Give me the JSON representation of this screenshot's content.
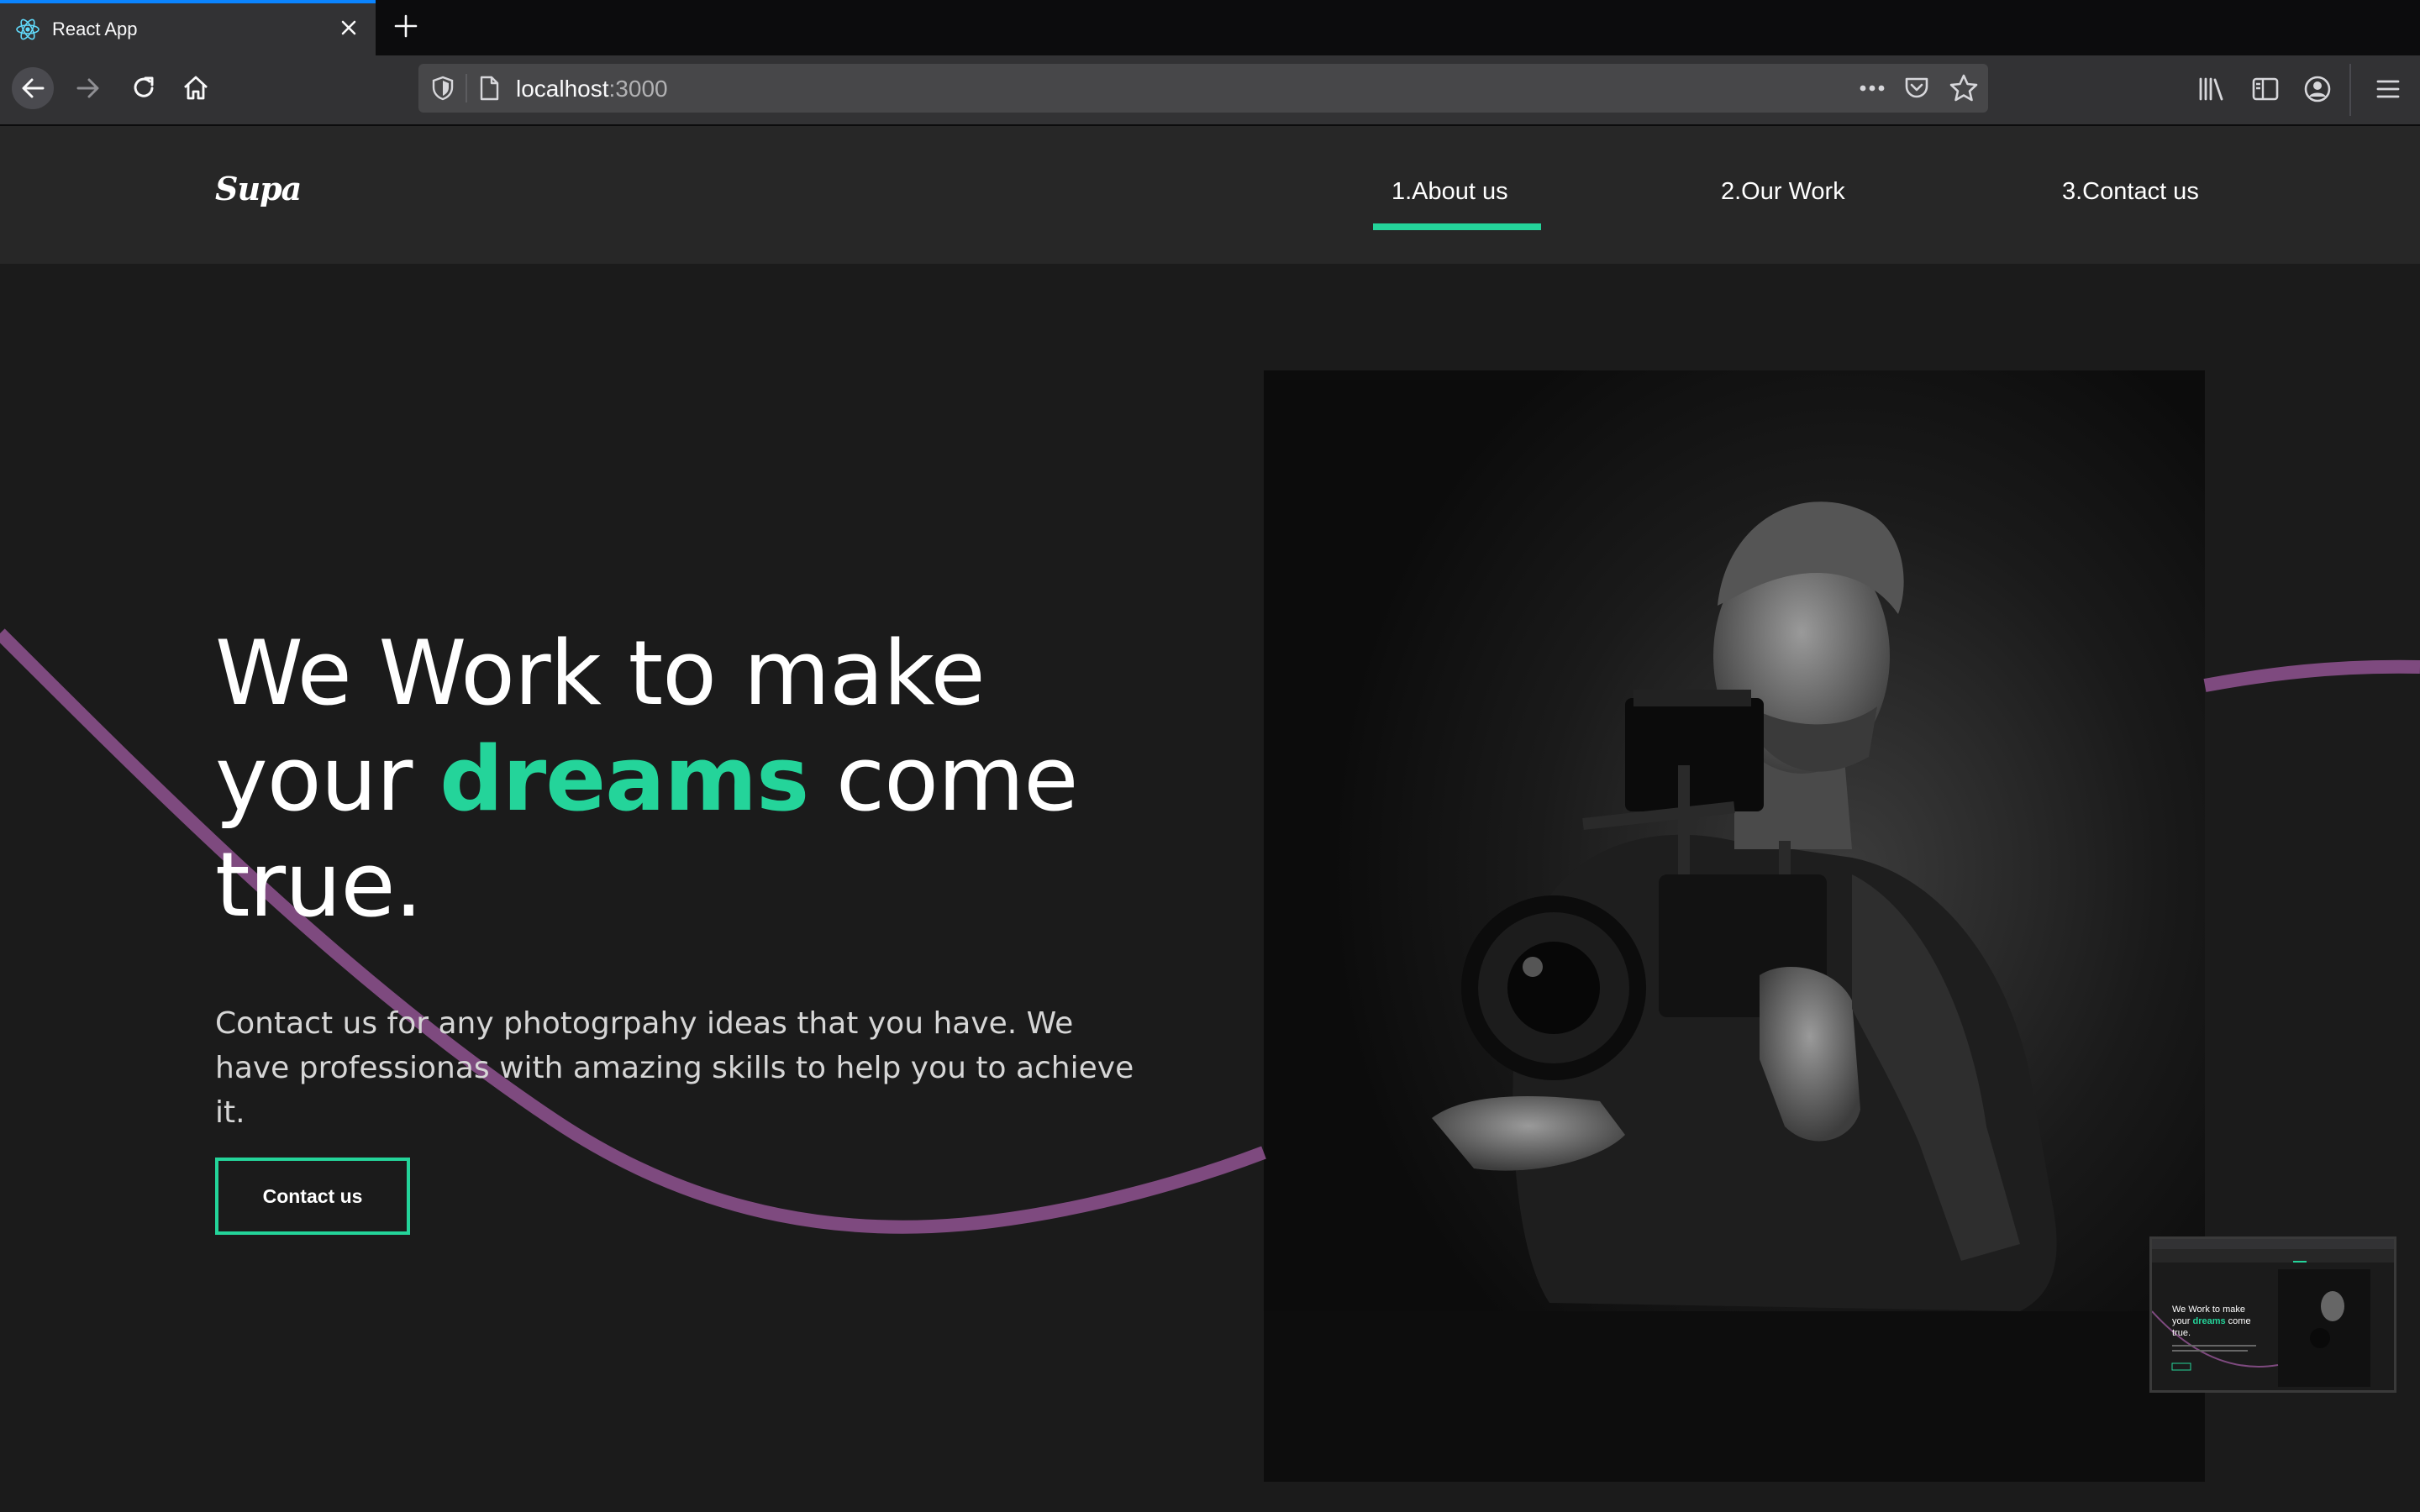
{
  "browser": {
    "tab_title": "React App",
    "url_host": "localhost",
    "url_port": ":3000",
    "accent": "#0a84ff"
  },
  "site": {
    "logo": "Supa",
    "nav": [
      "1.About us",
      "2.Our Work",
      "3.Contact us"
    ],
    "active_nav": "1.About us",
    "accent": "#24d49a",
    "wave_color": "#7e4a7f"
  },
  "hero": {
    "headline_line1": "We Work to make",
    "headline_your": "your",
    "headline_highlight": "dreams",
    "headline_come": "come",
    "headline_line3": "true.",
    "subtext": "Contact us for any photogrpahy ideas that you have. We have professionas with amazing skills to help you to achieve it.",
    "cta": "Contact us",
    "image": "black-and-white photo of a man filming with a cinema camera rig"
  },
  "pip_preview": {
    "line1": "We Work to make",
    "line2_pre": "your",
    "line2_hl": "dreams",
    "line2_post": "come",
    "line3": "true."
  },
  "icons": [
    "react-icon",
    "close-icon",
    "plus-icon",
    "back-icon",
    "forward-icon",
    "reload-icon",
    "home-icon",
    "shield-icon",
    "page-icon",
    "meatball-menu-icon",
    "pocket-icon",
    "star-icon",
    "library-icon",
    "sidebar-icon",
    "account-icon",
    "hamburger-menu-icon"
  ]
}
